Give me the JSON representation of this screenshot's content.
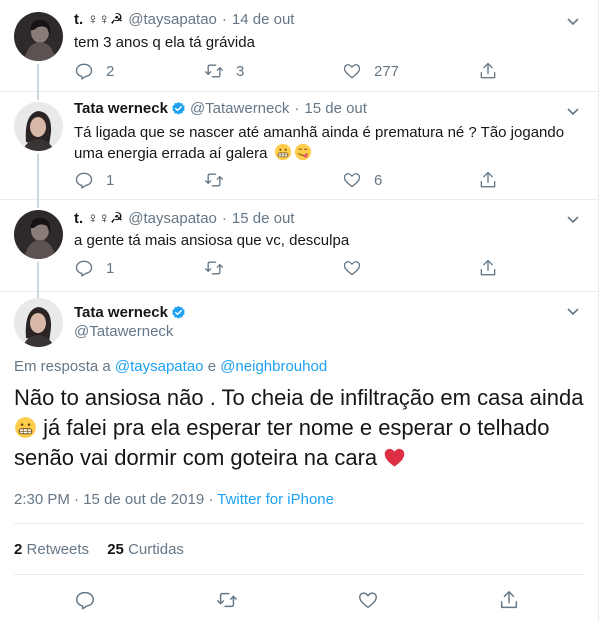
{
  "tweets": [
    {
      "name": "t. ♀♀☭",
      "handle": "@taysapatao",
      "date": "14 de out",
      "text": "tem 3 anos q ela tá grávida",
      "replies": "2",
      "retweets": "3",
      "likes": "277",
      "verified": false
    },
    {
      "name": "Tata werneck",
      "handle": "@Tatawerneck",
      "date": "15 de out",
      "text_line1": "Tá ligada que se nascer até amanhã ainda é prematura né ? Tão jogando",
      "text_line2": "uma energia errada aí galera",
      "replies": "1",
      "retweets": "",
      "likes": "6",
      "verified": true
    },
    {
      "name": "t. ♀♀☭",
      "handle": "@taysapatao",
      "date": "15 de out",
      "text": "a gente tá mais ansiosa que vc, desculpa",
      "replies": "1",
      "retweets": "",
      "likes": "",
      "verified": false
    }
  ],
  "main_tweet": {
    "name": "Tata werneck",
    "handle": "@Tatawerneck",
    "reply_prefix": "Em resposta a",
    "reply_user1": "@taysapatao",
    "reply_and": "e",
    "reply_user2": "@neighbrouhod",
    "text_line1": "Não to ansiosa não . To cheia de infiltração em casa ainda",
    "text_line2": "já falei pra ela esperar ter nome e esperar o telhado",
    "text_line3": "senão vai dormir com goteira na cara",
    "time": "2:30 PM",
    "date": "15 de out de 2019",
    "source": "Twitter for iPhone",
    "retweets_count": "2",
    "retweets_label": "Retweets",
    "likes_count": "25",
    "likes_label": "Curtidas"
  },
  "colors": {
    "link": "#1da1f2",
    "secondary_text": "#657786",
    "border": "#e6ecf0",
    "heart_red": "#e0245e"
  },
  "icons": [
    "reply-icon",
    "retweet-icon",
    "like-icon",
    "share-icon",
    "verified-badge-icon",
    "caret-down-icon",
    "grimacing-emoji-icon",
    "yum-emoji-icon",
    "red-heart-icon"
  ]
}
